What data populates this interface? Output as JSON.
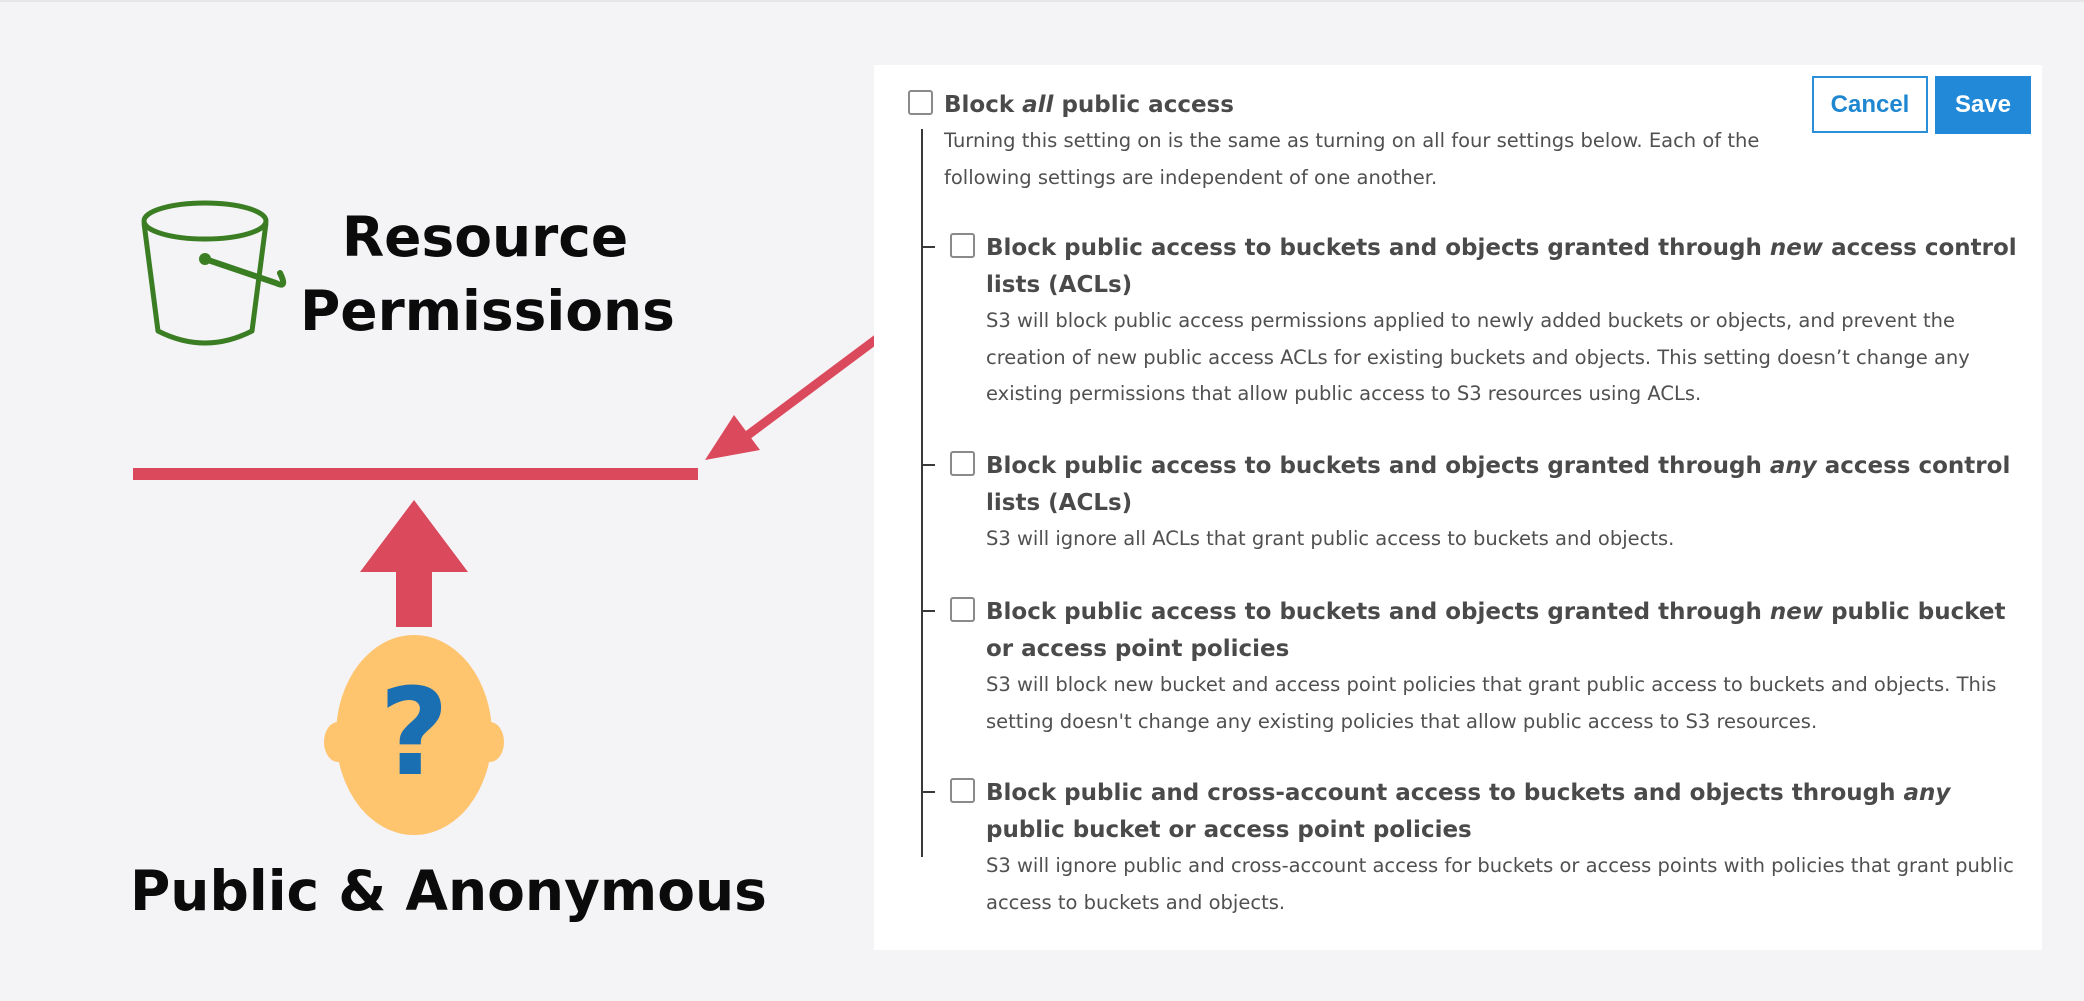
{
  "illustration": {
    "resource_line1": "Resource",
    "resource_line2": "Permissions",
    "public_label": "Public & Anonymous",
    "head_symbol": "?",
    "icons": [
      "bucket-icon",
      "person-head-icon",
      "arrow-up-icon",
      "arrow-pointer-icon"
    ],
    "colors": {
      "bucket_green": "#3b7d23",
      "barrier_red": "#db4a5c",
      "head_orange": "#fec46e",
      "question_blue": "#1a6fb3"
    }
  },
  "panel": {
    "buttons": {
      "cancel": "Cancel",
      "save": "Save"
    },
    "block_all": {
      "label_pre": "Block ",
      "label_em": "all",
      "label_post": " public access",
      "description": "Turning this setting on is the same as turning on all four settings below. Each of the following settings are independent of one another."
    },
    "options": [
      {
        "label_pre": "Block public access to buckets and objects granted through ",
        "label_em": "new",
        "label_post": " access control lists (ACLs)",
        "description": "S3 will block public access permissions applied to newly added buckets or objects, and prevent the creation of new public access ACLs for existing buckets and objects. This setting doesn’t change any existing permissions that allow public access to S3 resources using ACLs."
      },
      {
        "label_pre": "Block public access to buckets and objects granted through ",
        "label_em": "any",
        "label_post": " access control lists (ACLs)",
        "description": "S3 will ignore all ACLs that grant public access to buckets and objects."
      },
      {
        "label_pre": "Block public access to buckets and objects granted through ",
        "label_em": "new",
        "label_post": " public bucket or access point policies",
        "description": "S3 will block new bucket and access point policies that grant public access to buckets and objects. This setting doesn't change any existing policies that allow public access to S3 resources."
      },
      {
        "label_pre": "Block public and cross-account access to buckets and objects through ",
        "label_em": "any",
        "label_post": " public bucket or access point policies",
        "description": "S3 will ignore public and cross-account access for buckets or access points with policies that grant public access to buckets and objects."
      }
    ],
    "accent_color": "#2189d8"
  }
}
